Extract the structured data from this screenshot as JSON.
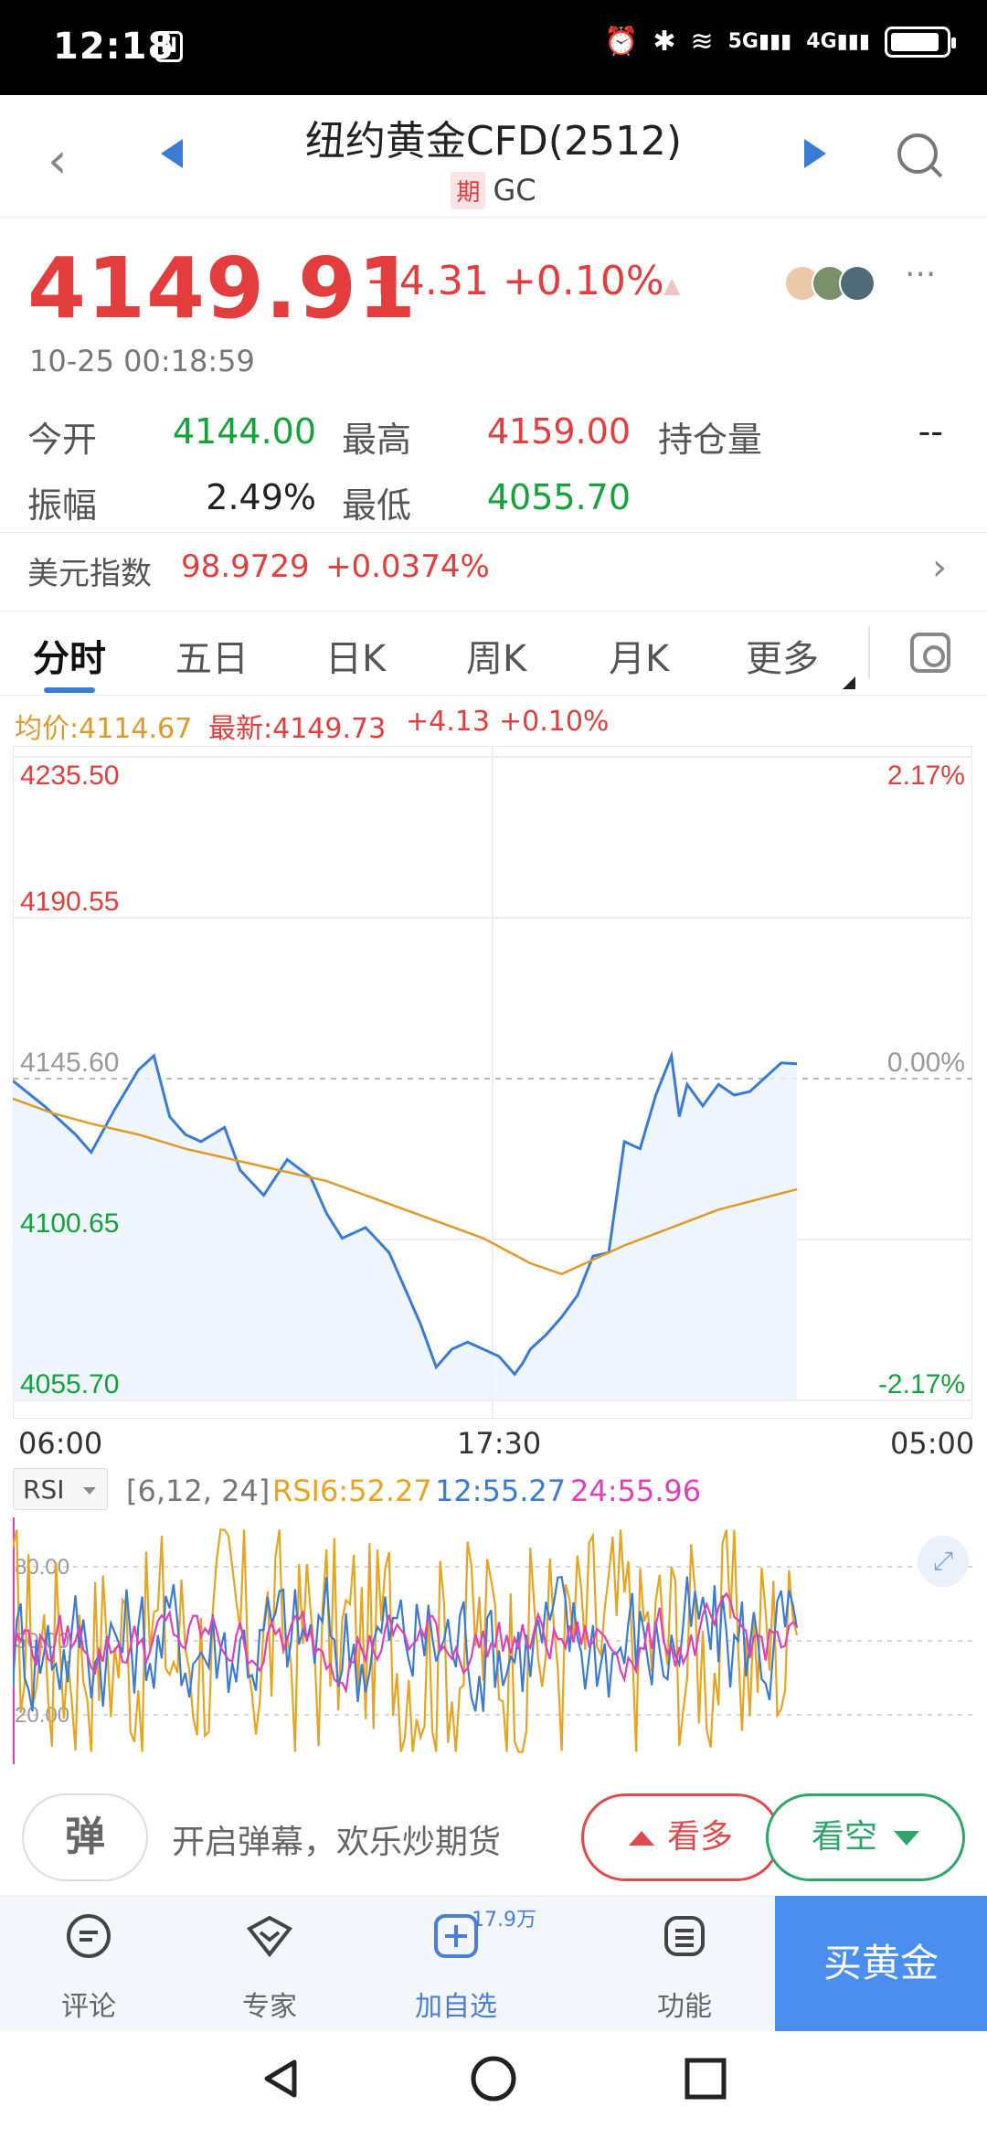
{
  "status": {
    "time": "12:18",
    "nfc": "N",
    "icons": [
      "alarm-icon",
      "bluetooth-icon",
      "wifi-icon",
      "5g-signal-icon",
      "4g-signal-icon",
      "battery-icon"
    ],
    "signal_5g": "5G",
    "signal_4g": "4G",
    "battery_level": 0.9
  },
  "header": {
    "title": "纽约黄金CFD(2512)",
    "tag": "期",
    "code": "GC"
  },
  "quote": {
    "price": "4149.91",
    "change": "+4.31",
    "change_pct": "+0.10%",
    "datetime": "10-25 00:18:59"
  },
  "stats": [
    {
      "label": "今开",
      "value": "4144.00",
      "color": "green"
    },
    {
      "label": "最高",
      "value": "4159.00",
      "color": "red"
    },
    {
      "label": "持仓量",
      "value": "--",
      "color": "dark"
    },
    {
      "label": "振幅",
      "value": "2.49%",
      "color": "dark"
    },
    {
      "label": "最低",
      "value": "4055.70",
      "color": "green"
    }
  ],
  "usd_index": {
    "label": "美元指数",
    "value": "98.9729",
    "change_pct": "+0.0374%"
  },
  "tabs": [
    "分时",
    "五日",
    "日K",
    "周K",
    "月K",
    "更多"
  ],
  "active_tab": "分时",
  "chart_info": {
    "avg": "均价:4114.67",
    "latest": "最新:4149.73",
    "change": "+4.13",
    "pct": "+0.10%"
  },
  "chart_data": [
    {
      "type": "line",
      "title": "",
      "y_ticks_left": [
        "4235.50",
        "4190.55",
        "4145.60",
        "4100.65",
        "4055.70"
      ],
      "y_ticks_right": [
        "2.17%",
        "",
        "0.00%",
        "",
        "-2.17%"
      ],
      "x_ticks": [
        "06:00",
        "17:30",
        "05:00"
      ],
      "ylim": [
        4055.7,
        4235.5
      ],
      "baseline": 4145.6,
      "series": [
        {
          "color": "#3a7bd5",
          "x": [
            0,
            4,
            8,
            10,
            13,
            16,
            18,
            20,
            22,
            24,
            27,
            29,
            32,
            35,
            38,
            40,
            42,
            45,
            48,
            50,
            52,
            54,
            56,
            58,
            60,
            62,
            64,
            65,
            66,
            68,
            70,
            72,
            74,
            76,
            78,
            80,
            82,
            84,
            85,
            86,
            88,
            90,
            92,
            94,
            96,
            98,
            100
          ],
          "y": [
            4145,
            4138,
            4130,
            4125,
            4137,
            4148,
            4152,
            4135,
            4130,
            4128,
            4132,
            4120,
            4113,
            4123,
            4118,
            4108,
            4101,
            4104,
            4097,
            4087,
            4077,
            4065,
            4070,
            4072,
            4070,
            4068,
            4063,
            4066,
            4070,
            4074,
            4079,
            4085,
            4096,
            4097,
            4128,
            4126,
            4141,
            4152,
            4135,
            4144,
            4138,
            4144,
            4141,
            4142,
            4146,
            4150,
            4149.73
          ]
        },
        {
          "color": "#e09a2b",
          "x": [
            0,
            5,
            10,
            16,
            22,
            30,
            40,
            50,
            60,
            66,
            70,
            74,
            78,
            84,
            90,
            100
          ],
          "y": [
            4140,
            4136,
            4133,
            4130,
            4126,
            4122,
            4117,
            4109,
            4101,
            4094,
            4091,
            4095,
            4099,
            4104,
            4109,
            4114.67
          ]
        }
      ]
    },
    {
      "type": "line",
      "title": "",
      "indicator": "RSI",
      "params": "[6,12, 24]",
      "y_ticks": [
        "80.00",
        "50.00",
        "20.00"
      ],
      "ylim": [
        0,
        100
      ],
      "series": [
        {
          "name": "RSI6",
          "value": "52.27",
          "color": "#e8a31f"
        },
        {
          "name": "12",
          "value": "55.27",
          "color": "#3a7bd5"
        },
        {
          "name": "24",
          "value": "55.96",
          "color": "#e040b8"
        }
      ]
    }
  ],
  "actions": {
    "danmu_icon": "弹",
    "danmu_text": "开启弹幕，欢乐炒期货",
    "bull": "看多",
    "bear": "看空"
  },
  "nav": {
    "items": [
      {
        "label": "评论",
        "icon": "comment-icon"
      },
      {
        "label": "专家",
        "icon": "expert-icon"
      },
      {
        "label": "加自选",
        "icon": "add-watchlist-icon"
      },
      {
        "label": "功能",
        "icon": "menu-icon"
      }
    ],
    "badge": "17.9万",
    "buy": "买黄金"
  }
}
